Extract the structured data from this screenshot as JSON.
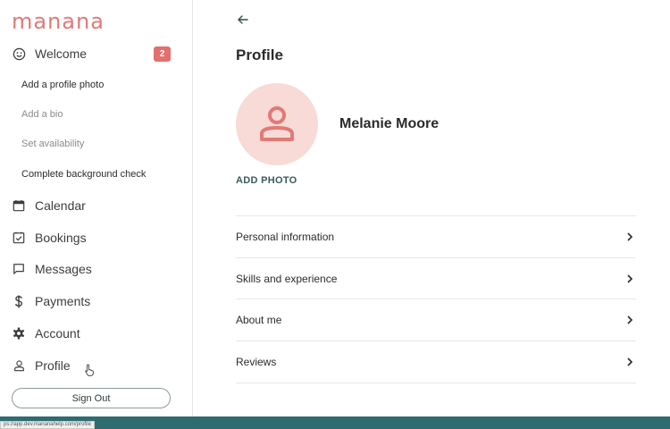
{
  "brand": {
    "logo": "manana",
    "accent": "#e07a76",
    "teal": "#2e6c70"
  },
  "sidebar": {
    "welcome": {
      "label": "Welcome",
      "badge": "2",
      "icon": "smile-icon"
    },
    "welcome_steps": [
      {
        "label": "Add a profile photo",
        "done": false
      },
      {
        "label": "Add a bio",
        "done": true
      },
      {
        "label": "Set availability",
        "done": true
      },
      {
        "label": "Complete background check",
        "done": false
      }
    ],
    "items": [
      {
        "label": "Calendar",
        "icon": "calendar-icon"
      },
      {
        "label": "Bookings",
        "icon": "checklist-icon"
      },
      {
        "label": "Messages",
        "icon": "chat-icon"
      },
      {
        "label": "Payments",
        "icon": "dollar-icon"
      },
      {
        "label": "Account",
        "icon": "gear-icon"
      },
      {
        "label": "Profile",
        "icon": "person-icon"
      }
    ],
    "sign_out": "Sign Out"
  },
  "main": {
    "title": "Profile",
    "user_name": "Melanie Moore",
    "add_photo": "ADD PHOTO",
    "sections": [
      {
        "label": "Personal information"
      },
      {
        "label": "Skills and experience"
      },
      {
        "label": "About me"
      },
      {
        "label": "Reviews"
      }
    ]
  },
  "status": {
    "url": "ps://app.dev.mananahelp.com/profile"
  }
}
